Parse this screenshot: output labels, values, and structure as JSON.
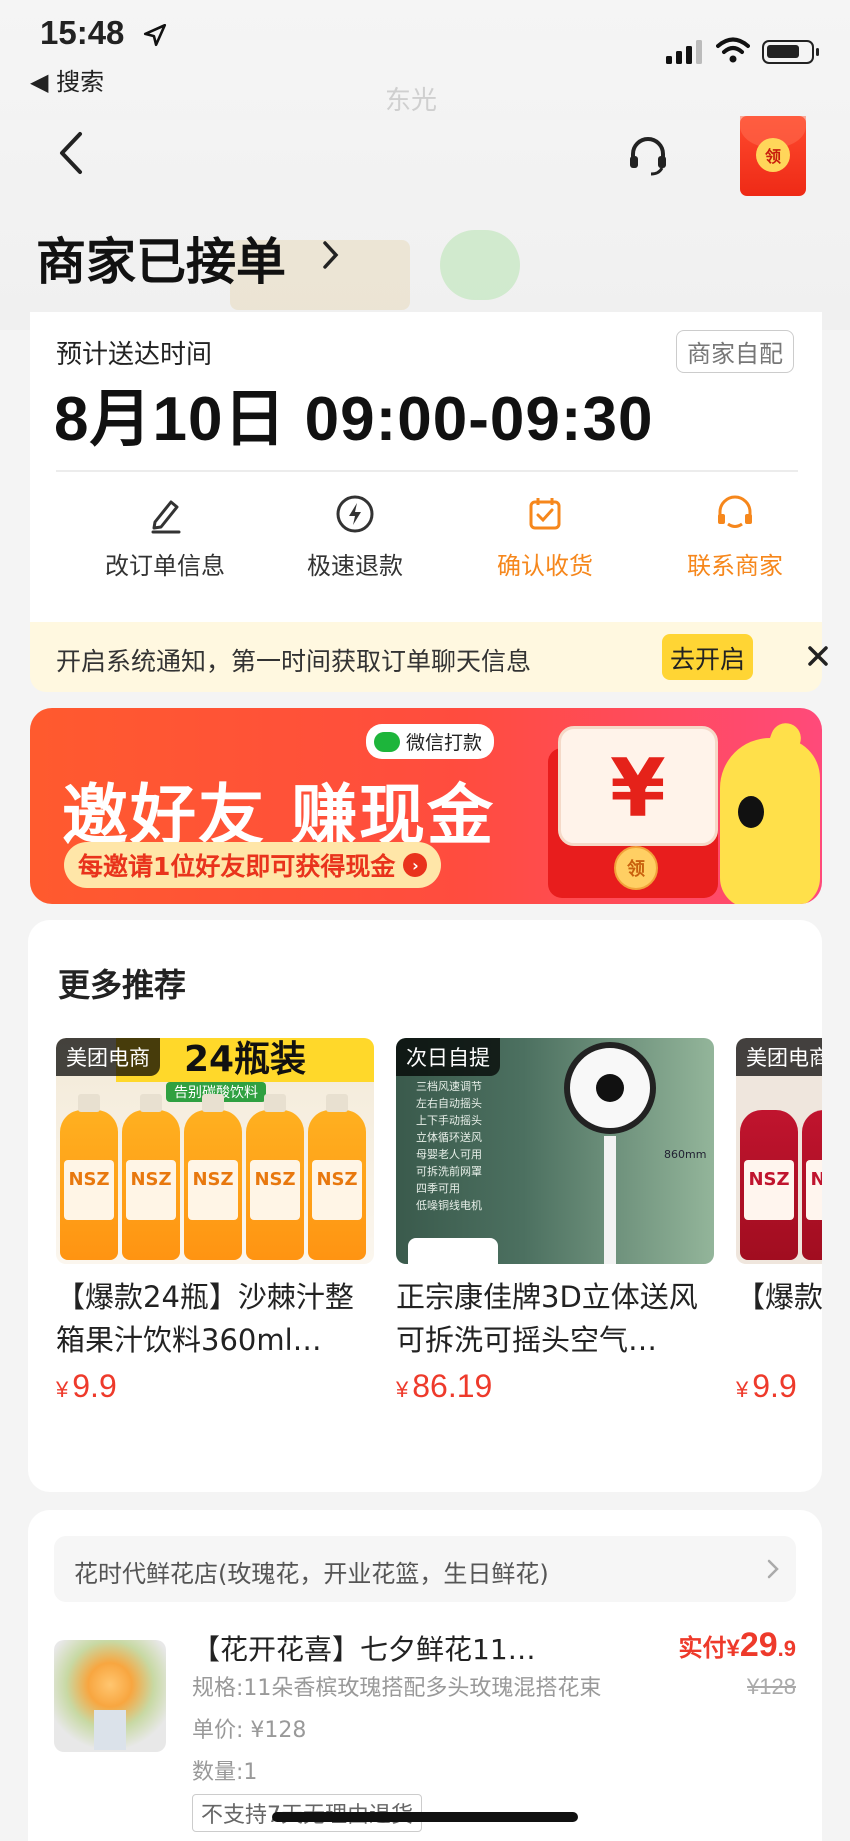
{
  "status_bar": {
    "time": "15:48",
    "back_app": "◀ 搜索"
  },
  "map_bg": {
    "label": "东光"
  },
  "nav": {
    "redpacket_label": "领"
  },
  "order_status": {
    "title": "商家已接单"
  },
  "delivery": {
    "est_label": "预计送达时间",
    "mode": "商家自配",
    "est_time": "8月10日 09:00-09:30",
    "actions": [
      {
        "label": "改订单信息",
        "icon": "pencil-icon",
        "highlight": false
      },
      {
        "label": "极速退款",
        "icon": "lightning-icon",
        "highlight": false
      },
      {
        "label": "确认收货",
        "icon": "calendar-check-icon",
        "highlight": true
      },
      {
        "label": "联系商家",
        "icon": "merchant-service-icon",
        "highlight": true
      }
    ]
  },
  "notice": {
    "text": "开启系统通知，第一时间获取订单聊天信息",
    "button": "去开启"
  },
  "promo_banner": {
    "wechat_tag": "微信打款",
    "headline": "邀好友 赚现金",
    "subline": "每邀请1位好友即可获得现金",
    "currency": "¥",
    "coin": "领"
  },
  "recommendations": {
    "title": "更多推荐",
    "items": [
      {
        "tag": "美团电商",
        "name": "【爆款24瓶】沙棘汁整箱果汁饮料360ml…",
        "price": "9.9",
        "img_text": "24瓶装",
        "img_sub": "告别碳酸饮料",
        "bottle_label": "NSZ"
      },
      {
        "tag": "次日自提",
        "name": "正宗康佳牌3D立体送风可拆洗可摇头空气…",
        "price": "86.19",
        "features": [
          "三档风速调节",
          "左右自动摇头",
          "上下手动摇头",
          "立体循环送风",
          "母婴老人可用",
          "可拆洗前网罩",
          "四季可用",
          "低噪铜线电机"
        ],
        "dimension": "860mm"
      },
      {
        "tag": "美团电商",
        "name": "【爆款葚汁饮",
        "price": "9.9",
        "bottle_label": "NSZ"
      }
    ],
    "currency_symbol": "¥"
  },
  "order": {
    "shop_name": "花时代鲜花店(玫瑰花，开业花篮，生日鲜花)",
    "product_name": "【花开花喜】七夕鲜花11…",
    "spec": "规格:11朵香槟玫瑰搭配多头玫瑰混搭花束",
    "unit_price": "单价: ¥128",
    "quantity": "数量:1",
    "policy": "不支持7天无理由退货",
    "paid_label": "实付¥",
    "paid_int": "29",
    "paid_dec": ".9",
    "original_price": "¥128"
  },
  "colors": {
    "accent_orange": "#f6871c",
    "price_red": "#ee3a2b",
    "notice_bg": "#fff8e0",
    "notice_btn": "#ffd534"
  }
}
